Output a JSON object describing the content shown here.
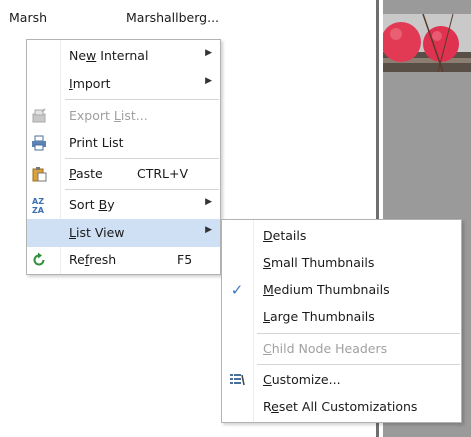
{
  "background": {
    "columns": [
      "Marsh",
      "Marshallberg..."
    ]
  },
  "context_menu": {
    "items": [
      {
        "label": "New Internal",
        "mnemonic_index": 2,
        "submenu": true
      },
      {
        "label": "Import",
        "mnemonic_index": 0,
        "submenu": true
      },
      {
        "label": "Export List...",
        "disabled": true,
        "icon": "export-list-icon"
      },
      {
        "label": "Print List",
        "icon": "printer-icon"
      },
      {
        "label": "Paste",
        "shortcut": "CTRL+V",
        "icon": "paste-icon"
      },
      {
        "label": "Sort By",
        "submenu": true,
        "icon": "sort-az-icon"
      },
      {
        "label": "List View",
        "submenu": true,
        "highlighted": true
      },
      {
        "label": "Refresh",
        "shortcut": "F5",
        "icon": "refresh-icon"
      }
    ]
  },
  "list_view_submenu": {
    "items": [
      {
        "label": "Details"
      },
      {
        "label": "Small Thumbnails"
      },
      {
        "label": "Medium Thumbnails",
        "checked": true
      },
      {
        "label": "Large Thumbnails"
      },
      {
        "label": "Child Node Headers",
        "disabled": true
      },
      {
        "label": "Customize...",
        "icon": "customize-icon"
      },
      {
        "label": "Reset All Customizations"
      }
    ]
  },
  "colors": {
    "highlight": "#cfe0f4",
    "check_mark": "#3a78c8",
    "disabled_text": "#a0a0a0"
  }
}
